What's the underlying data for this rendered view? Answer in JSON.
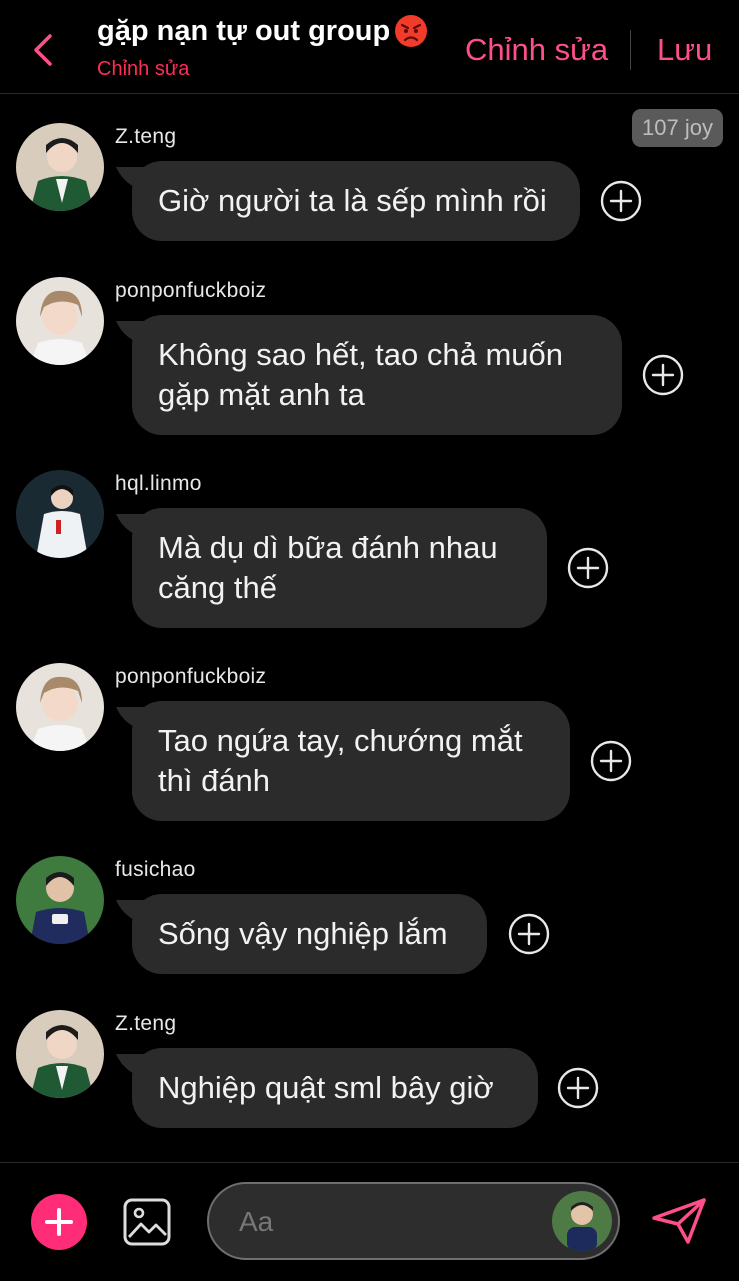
{
  "header": {
    "title": "gặp nạn tự out group",
    "subtitle": "Chỉnh sửa",
    "edit_label": "Chỉnh sửa",
    "save_label": "Lưu",
    "title_emoji": "angry-face-emoji",
    "back_icon": "chevron-left-icon"
  },
  "joy_badge": "107 joy",
  "messages": [
    {
      "username": "Z.teng",
      "lines": [
        "Giờ người ta là sếp mình rồi"
      ]
    },
    {
      "username": "ponponfuckboiz",
      "lines": [
        "Không sao hết, tao chả muốn",
        "gặp mặt anh ta"
      ]
    },
    {
      "username": "hql.linmo",
      "lines": [
        "Mà dụ dì bữa đánh nhau",
        "căng thế"
      ]
    },
    {
      "username": "ponponfuckboiz",
      "lines": [
        "Tao ngứa tay, chướng mắt",
        "thì đánh"
      ]
    },
    {
      "username": "fusichao",
      "lines": [
        "Sống vậy nghiệp lắm"
      ]
    },
    {
      "username": "Z.teng",
      "lines": [
        "Nghiệp quật sml bây giờ"
      ]
    }
  ],
  "composer": {
    "placeholder": "Aa",
    "add_icon": "plus-icon",
    "image_icon": "image-icon",
    "send_icon": "send-icon"
  },
  "colors": {
    "accent": "#ff4f8b",
    "subtitle": "#ff2d55",
    "bubble": "#2b2b2b",
    "background": "#000000"
  }
}
